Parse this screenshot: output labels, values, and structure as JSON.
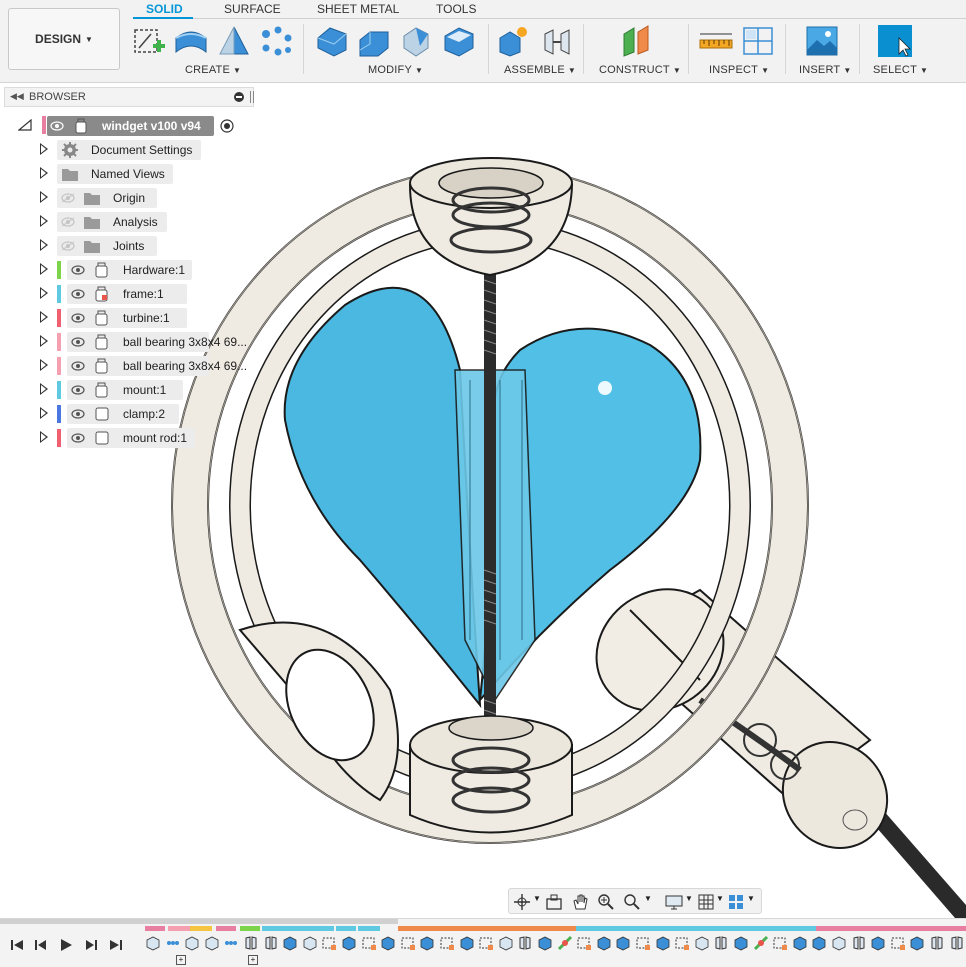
{
  "toolbar": {
    "workspace_button": "DESIGN",
    "tabs": [
      {
        "label": "SOLID",
        "active": true
      },
      {
        "label": "SURFACE",
        "active": false
      },
      {
        "label": "SHEET METAL",
        "active": false
      },
      {
        "label": "TOOLS",
        "active": false
      }
    ],
    "groups": {
      "create": "CREATE",
      "modify": "MODIFY",
      "assemble": "ASSEMBLE",
      "construct": "CONSTRUCT",
      "inspect": "INSPECT",
      "insert": "INSERT",
      "select": "SELECT"
    },
    "accent_color": "#0696d7"
  },
  "browser": {
    "title": "BROWSER",
    "root": {
      "label": "windget v100 v94",
      "color": "#e87ea0"
    },
    "items": [
      {
        "label": "Document Settings",
        "icon": "gear-icon",
        "color": null
      },
      {
        "label": "Named Views",
        "icon": "folder-icon",
        "color": null
      },
      {
        "label": "Origin",
        "icon": "folder-icon",
        "color": null
      },
      {
        "label": "Analysis",
        "icon": "folder-icon",
        "color": null
      },
      {
        "label": "Joints",
        "icon": "folder-icon",
        "color": null
      },
      {
        "label": "Hardware:1",
        "icon": "component-icon",
        "color": "#7cd44a"
      },
      {
        "label": "frame:1",
        "icon": "component-icon",
        "color": "#5ec9e0"
      },
      {
        "label": "turbine:1",
        "icon": "component-icon",
        "color": "#f06070"
      },
      {
        "label": "ball bearing 3x8x4 69...",
        "icon": "component-icon",
        "color": "#f4a0b0"
      },
      {
        "label": "ball bearing 3x8x4 69...",
        "icon": "component-icon",
        "color": "#f4a0b0"
      },
      {
        "label": "mount:1",
        "icon": "component-icon",
        "color": "#5ec9e0"
      },
      {
        "label": "clamp:2",
        "icon": "body-icon",
        "color": "#4a78e0"
      },
      {
        "label": "mount rod:1",
        "icon": "body-icon",
        "color": "#f06070"
      }
    ]
  },
  "viewport": {
    "model_colors": {
      "frame": "#efebe2",
      "turbine": "#4ab8e0",
      "edge": "#1a1a1a"
    }
  },
  "timeline": {
    "controls": [
      "skip-start-icon",
      "step-back-icon",
      "play-icon",
      "step-forward-icon",
      "skip-end-icon"
    ]
  }
}
